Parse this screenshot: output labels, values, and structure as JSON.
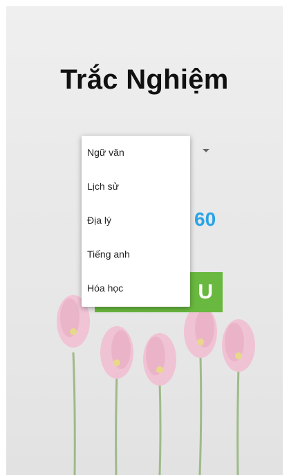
{
  "app": {
    "title": "Trắc Nghiệm"
  },
  "subject_dropdown": {
    "options": [
      "Ngữ văn",
      "Lịch sử",
      "Địa lý",
      "Tiếng anh",
      "Hóa học"
    ]
  },
  "time": {
    "value": "60"
  },
  "start_button": {
    "label_visible": "U"
  },
  "icons": {
    "spinner": "dropdown-arrow-icon"
  },
  "colors": {
    "title": "#111111",
    "time_value": "#2aa3e6",
    "start_button_bg": "#69b83f",
    "flower_petal": "#f2c4d6",
    "flower_center": "#e8d68a",
    "stem": "#8fb07a"
  }
}
